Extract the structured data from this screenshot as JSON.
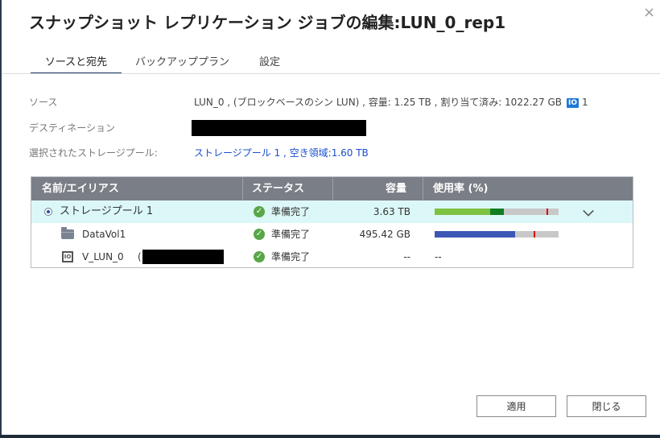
{
  "dialog": {
    "title": "スナップショット レプリケーション ジョブの編集:LUN_0_rep1",
    "close_glyph": "×"
  },
  "tabs": [
    {
      "label": "ソースと宛先",
      "active": true
    },
    {
      "label": "バックアッププラン",
      "active": false
    },
    {
      "label": "設定",
      "active": false
    }
  ],
  "info": {
    "source_label": "ソース",
    "source_value": "LUN_0 , (ブロックベースのシン LUN) , 容量: 1.25 TB , 割り当て済み: 1022.27 GB",
    "snapshot_badge": "IO",
    "snapshot_count": "1",
    "destination_label": "デスティネーション",
    "pool_label": "選択されたストレージプール:",
    "pool_value": "ストレージプール 1 , 空き領域:1.60 TB"
  },
  "table": {
    "headers": [
      "名前/エイリアス",
      "ステータス",
      "容量",
      "使用率 (%)"
    ],
    "rows": [
      {
        "name": "ストレージプール 1",
        "status": "準備完了",
        "capacity": "3.63 TB",
        "usage": "",
        "icon": "radio-selected"
      },
      {
        "name": "DataVol1",
        "status": "準備完了",
        "capacity": "495.42 GB",
        "usage": "",
        "icon": "folder-icon"
      },
      {
        "name": "V_LUN_0",
        "name_suffix": "(",
        "status": "準備完了",
        "capacity": "--",
        "usage": "--",
        "icon": "lun-icon"
      }
    ],
    "usage_bars": {
      "pool": {
        "used_fraction": 0.45,
        "snapshot_fraction": 0.11,
        "threshold_fraction": 0.9,
        "used_color": "#7ec242",
        "snapshot_color": "#127d22"
      },
      "datavol": {
        "used_fraction": 0.65,
        "threshold_fraction": 0.8,
        "used_color": "#3d57b5"
      }
    }
  },
  "buttons": {
    "apply": "適用",
    "close": "閉じる"
  },
  "colors": {
    "accent": "#1f3e66",
    "link": "#1a4fd0",
    "ok": "#58a648",
    "header_bg": "#7a7e86",
    "selected_row": "#dcf7f7"
  }
}
